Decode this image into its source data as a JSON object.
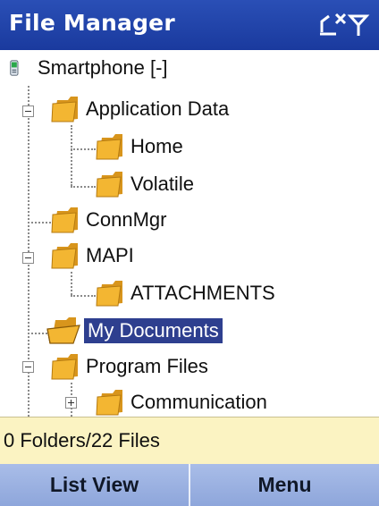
{
  "title_bar": {
    "title": "File Manager",
    "status_icon": "no-signal-icon"
  },
  "tree": {
    "items": [
      {
        "label": "Smartphone [-]",
        "icon": "smartphone-icon",
        "depth": 0,
        "expander": "none"
      },
      {
        "label": "Application Data",
        "icon": "folder-icon",
        "depth": 1,
        "expander": "collapse"
      },
      {
        "label": "Home",
        "icon": "folder-icon",
        "depth": 2,
        "expander": "none"
      },
      {
        "label": "Volatile",
        "icon": "folder-icon",
        "depth": 2,
        "expander": "none"
      },
      {
        "label": "ConnMgr",
        "icon": "folder-icon",
        "depth": 1,
        "expander": "none"
      },
      {
        "label": "MAPI",
        "icon": "folder-icon",
        "depth": 1,
        "expander": "collapse"
      },
      {
        "label": "ATTACHMENTS",
        "icon": "folder-icon",
        "depth": 2,
        "expander": "none"
      },
      {
        "label": "My Documents",
        "icon": "open-folder-icon",
        "depth": 1,
        "expander": "none",
        "selected": true
      },
      {
        "label": "Program Files",
        "icon": "folder-icon",
        "depth": 1,
        "expander": "collapse"
      },
      {
        "label": "Communication",
        "icon": "folder-icon",
        "depth": 2,
        "expander": "expand"
      }
    ]
  },
  "status_bar": {
    "text": "0 Folders/22 Files"
  },
  "softkeys": {
    "left_label": "List View",
    "right_label": "Menu"
  },
  "colors": {
    "title_bar": "#1f43a8",
    "selection": "#2e3f8f",
    "status_bar": "#fbf3c2",
    "softkeys": "#9fb4e4",
    "folder": "#f3b632"
  }
}
